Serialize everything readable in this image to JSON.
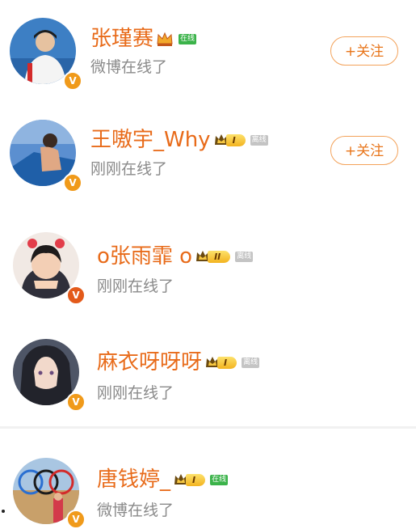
{
  "users": [
    {
      "name": "张瑾赛",
      "status": "微博在线了",
      "badge": "在线",
      "level": "",
      "follow_label": "+关注"
    },
    {
      "name": "王嗷宇_Why",
      "status": "刚刚在线了",
      "badge": "离线",
      "level": "I",
      "follow_label": "+关注"
    },
    {
      "name": "o张雨霏 o",
      "status": "刚刚在线了",
      "badge": "离线",
      "level": "II"
    },
    {
      "name": "麻衣呀呀呀",
      "status": "刚刚在线了",
      "badge": "离线",
      "level": "I"
    },
    {
      "name": "唐钱婷_",
      "status": "微博在线了",
      "badge": "在线",
      "level": "I"
    }
  ],
  "verified_mark": "V",
  "colors": {
    "name": "#e86b1a",
    "status": "#8a8a8a",
    "online": "#3bb34a",
    "offline": "#c4c4c4",
    "follow_border": "#f3a25a"
  }
}
